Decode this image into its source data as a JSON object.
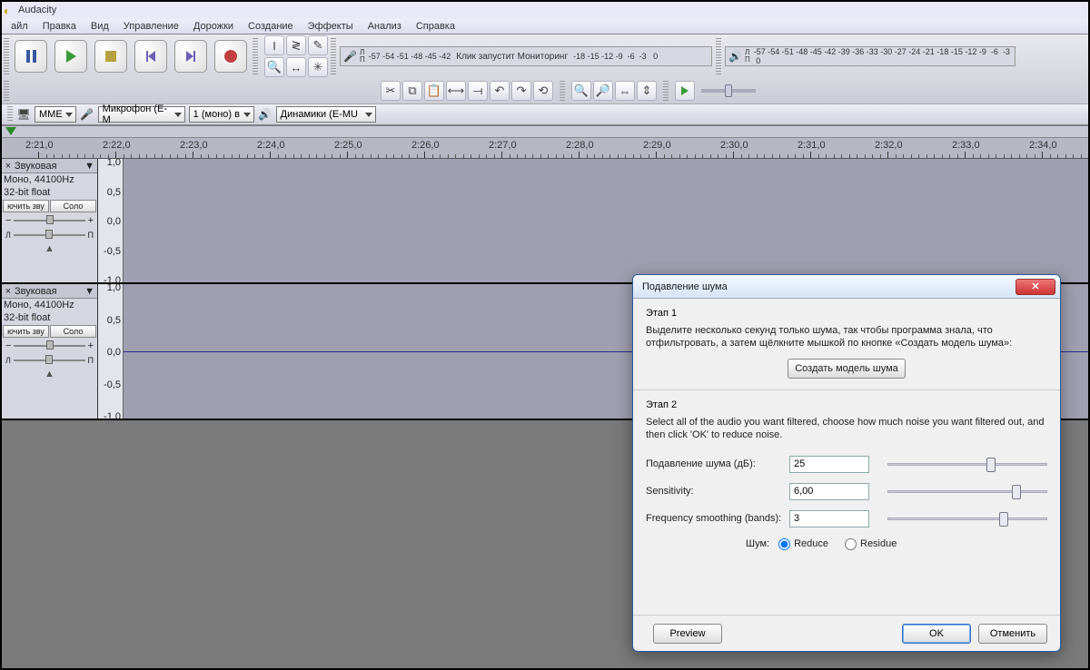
{
  "app": {
    "title": "Audacity"
  },
  "menu": [
    "айл",
    "Правка",
    "Вид",
    "Управление",
    "Дорожки",
    "Создание",
    "Эффекты",
    "Анализ",
    "Справка"
  ],
  "transport_icons": [
    "pause",
    "play",
    "stop",
    "skip-start",
    "skip-end",
    "record"
  ],
  "meter_rec_text": "Клик запустит Мониторинг",
  "devicebar": {
    "host": "MME",
    "input": "Микрофон (E-M",
    "channels": "1 (моно) в",
    "output": "Динамики (E-MU"
  },
  "timeline": {
    "labels": [
      "2:21,0",
      "2:22,0",
      "2:23,0",
      "2:24,0",
      "2:25,0",
      "2:26,0",
      "2:27,0",
      "2:28,0",
      "2:29,0",
      "2:30,0",
      "2:31,0",
      "2:32,0",
      "2:33,0",
      "2:34,0"
    ]
  },
  "track": {
    "name": "Звуковая",
    "info1": "Моно, 44100Hz",
    "info2": "32-bit float",
    "mute": "ючить зву",
    "solo": "Соло",
    "vscale": [
      "1,0",
      "0,5",
      "0,0",
      "-0,5",
      "-1,0"
    ]
  },
  "dialog": {
    "title": "Подавление шума",
    "step1_h": "Этап 1",
    "step1_p": "Выделите несколько секунд только шума, так чтобы программа знала, что отфильтровать, а затем щёлкните мышкой по кнопке «Создать модель шума»:",
    "get_profile": "Создать модель шума",
    "step2_h": "Этап 2",
    "step2_p": "Select all of the audio you want filtered, choose how much noise you want filtered out, and then click 'OK' to reduce noise.",
    "p1_label": "Подавление шума (дБ):",
    "p1_val": "25",
    "p2_label": "Sensitivity:",
    "p2_val": "6,00",
    "p3_label": "Frequency smoothing (bands):",
    "p3_val": "3",
    "noise_label": "Шум:",
    "opt_reduce": "Reduce",
    "opt_residue": "Residue",
    "preview": "Preview",
    "ok": "OK",
    "cancel": "Отменить"
  },
  "meter_ticks": [
    "-57",
    "-54",
    "-51",
    "-48",
    "-45",
    "-42"
  ],
  "meter_ticks2": [
    "-18",
    "-15",
    "-12",
    "-9",
    "-6",
    "-3",
    "0"
  ]
}
